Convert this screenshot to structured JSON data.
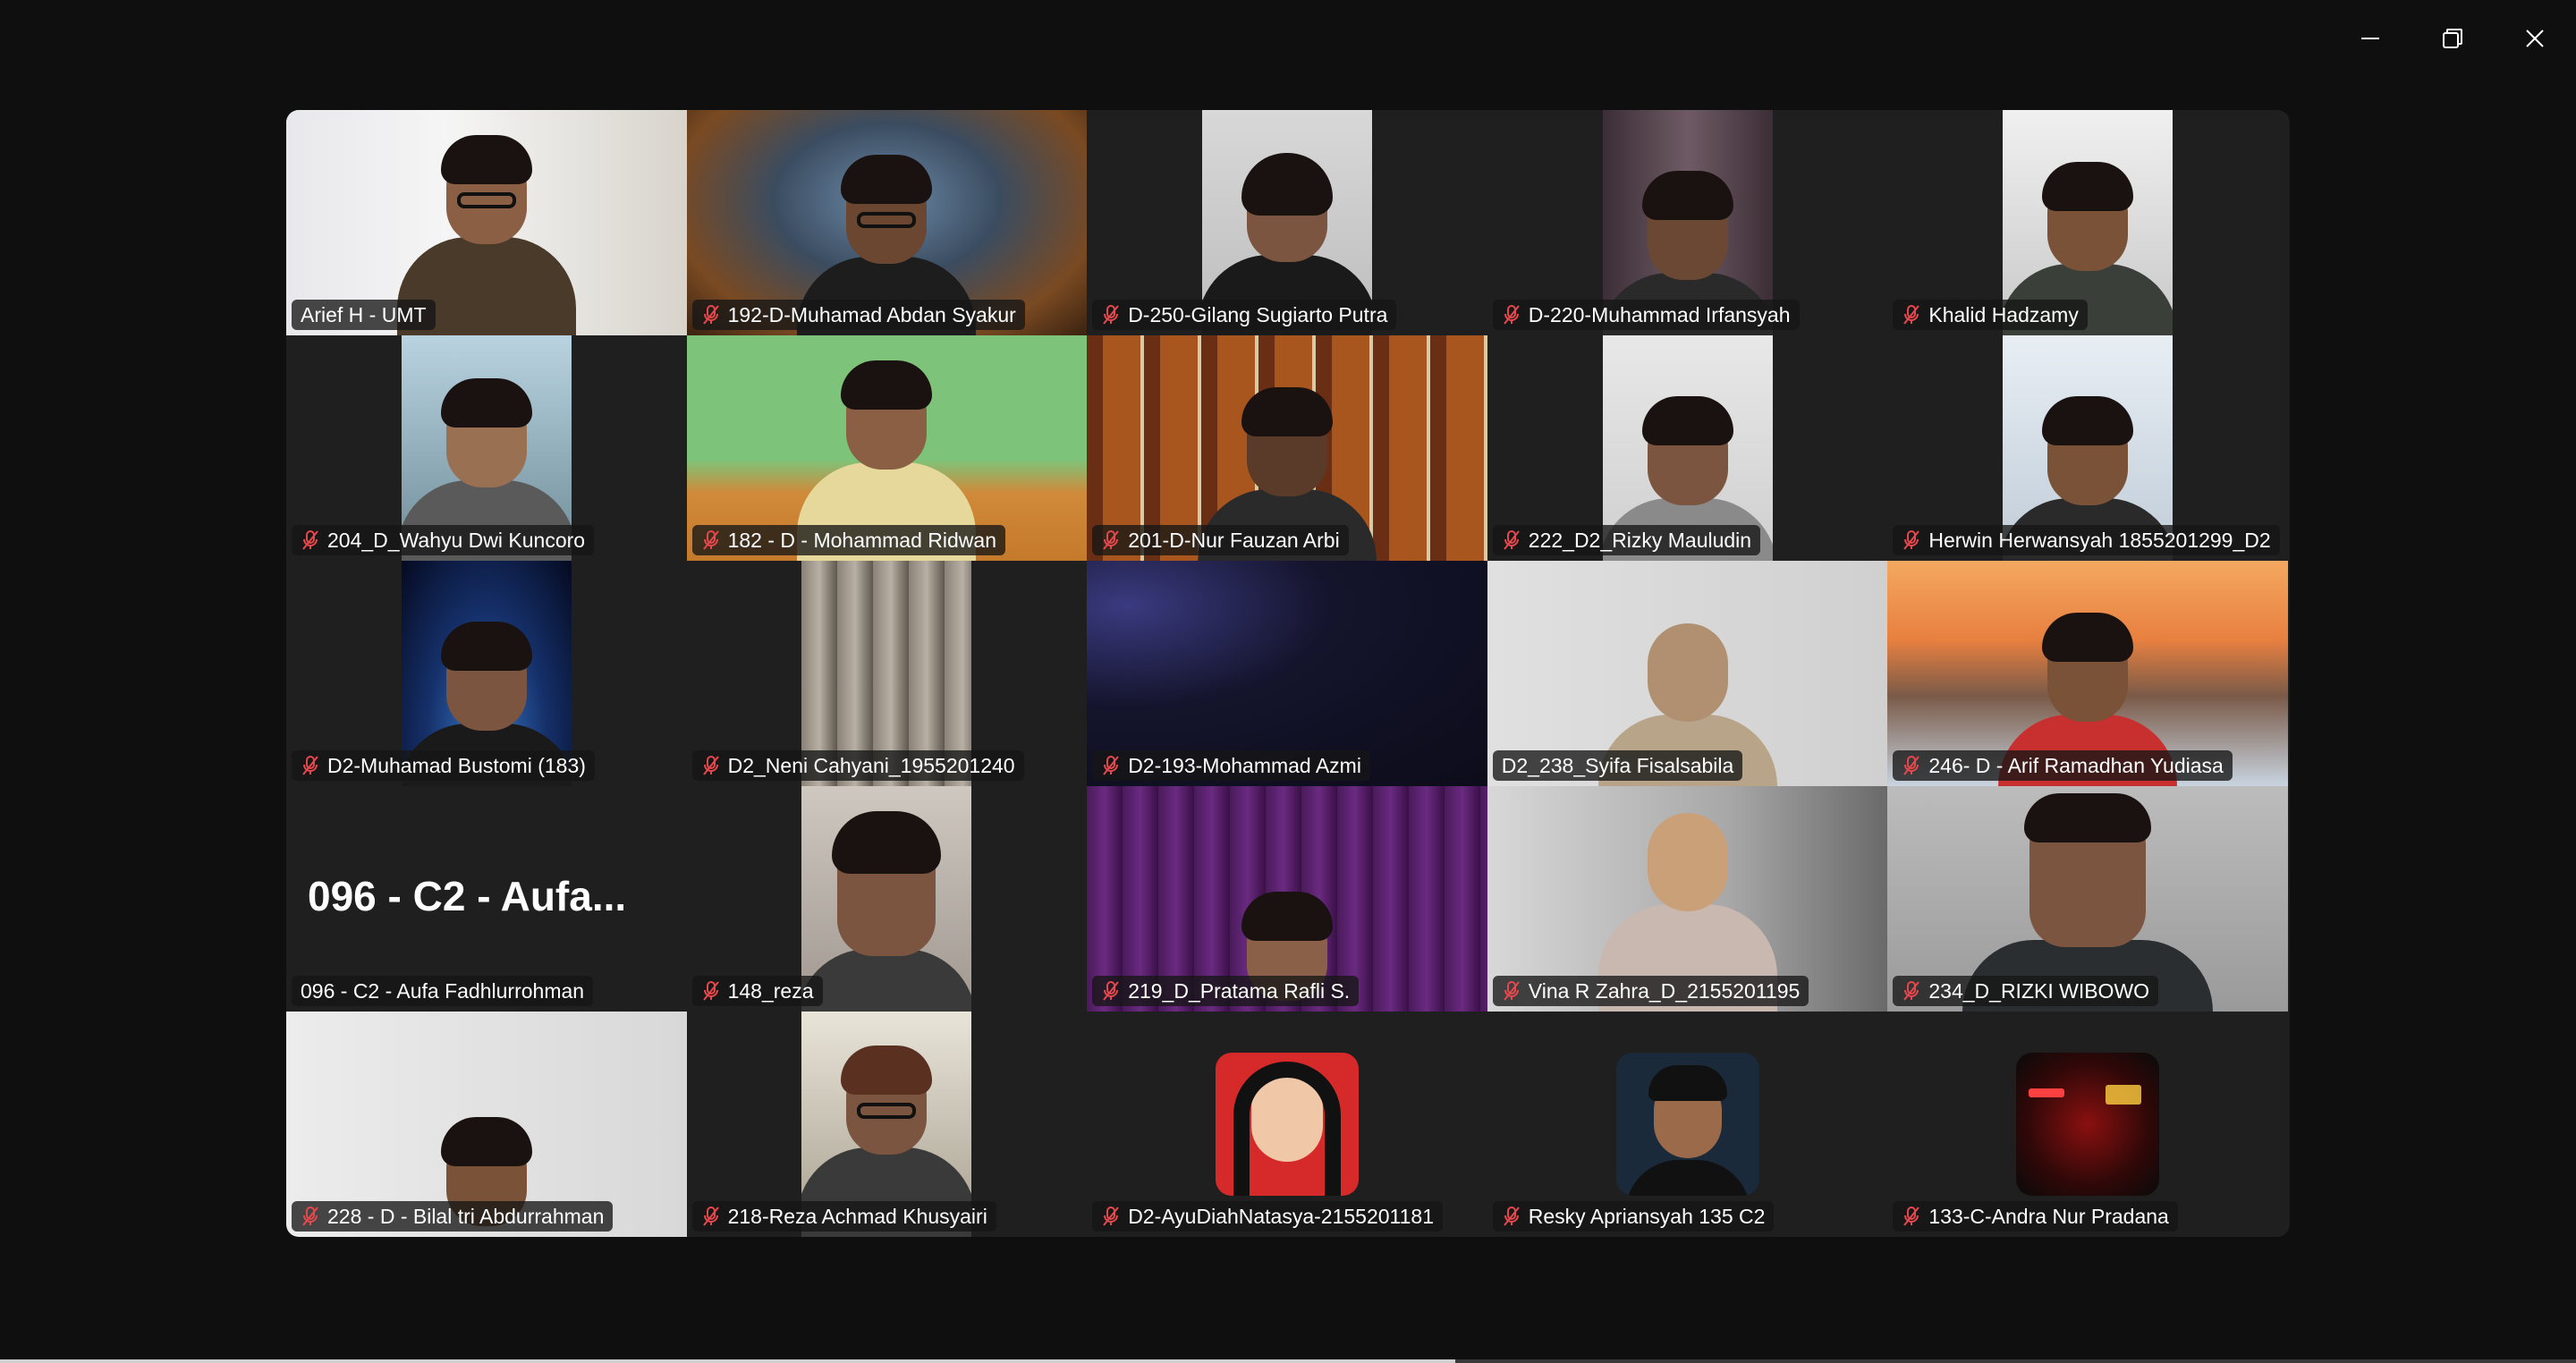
{
  "window": {
    "controls": [
      "minimize",
      "restore",
      "close"
    ]
  },
  "active_speaker": "Arief H - UMT",
  "participants": [
    {
      "name": "Arief H - UMT",
      "muted": false
    },
    {
      "name": "192-D-Muhamad Abdan Syakur",
      "muted": true
    },
    {
      "name": "D-250-Gilang Sugiarto Putra",
      "muted": true
    },
    {
      "name": "D-220-Muhammad Irfansyah",
      "muted": true
    },
    {
      "name": "Khalid Hadzamy",
      "muted": true
    },
    {
      "name": "204_D_Wahyu Dwi Kuncoro",
      "muted": true
    },
    {
      "name": "182 - D - Mohammad Ridwan",
      "muted": true
    },
    {
      "name": "201-D-Nur Fauzan Arbi",
      "muted": true
    },
    {
      "name": "222_D2_Rizky Mauludin",
      "muted": true
    },
    {
      "name": "Herwin Herwansyah 1855201299_D2",
      "muted": true
    },
    {
      "name": "D2-Muhamad Bustomi (183)",
      "muted": true
    },
    {
      "name": "D2_Neni Cahyani_1955201240",
      "muted": true
    },
    {
      "name": "D2-193-Mohammad Azmi",
      "muted": true
    },
    {
      "name": "D2_238_Syifa Fisalsabila",
      "muted": false
    },
    {
      "name": "246- D - Arif Ramadhan Yudiasa",
      "muted": true
    },
    {
      "name": "096 - C2 - Aufa Fadhlurrohman",
      "muted": false,
      "display_text": "096 - C2 - Aufa..."
    },
    {
      "name": "148_reza",
      "muted": true
    },
    {
      "name": "219_D_Pratama Rafli S.",
      "muted": true
    },
    {
      "name": "Vina R Zahra_D_2155201195",
      "muted": true
    },
    {
      "name": "234_D_RIZKI WIBOWO",
      "muted": true
    },
    {
      "name": "228 - D - Bilal tri Abdurrahman",
      "muted": true
    },
    {
      "name": "218-Reza Achmad Khusyairi",
      "muted": true
    },
    {
      "name": "D2-AyuDiahNatasya-2155201181",
      "muted": true
    },
    {
      "name": "Resky Apriansyah 135 C2",
      "muted": true
    },
    {
      "name": "133-C-Andra Nur Pradana",
      "muted": true
    }
  ],
  "progress": 0.565,
  "colors": {
    "active_border": "#23d18b",
    "background": "#0f0f0f",
    "tile": "#1f1f1f",
    "muted_icon": "#e5484d"
  }
}
